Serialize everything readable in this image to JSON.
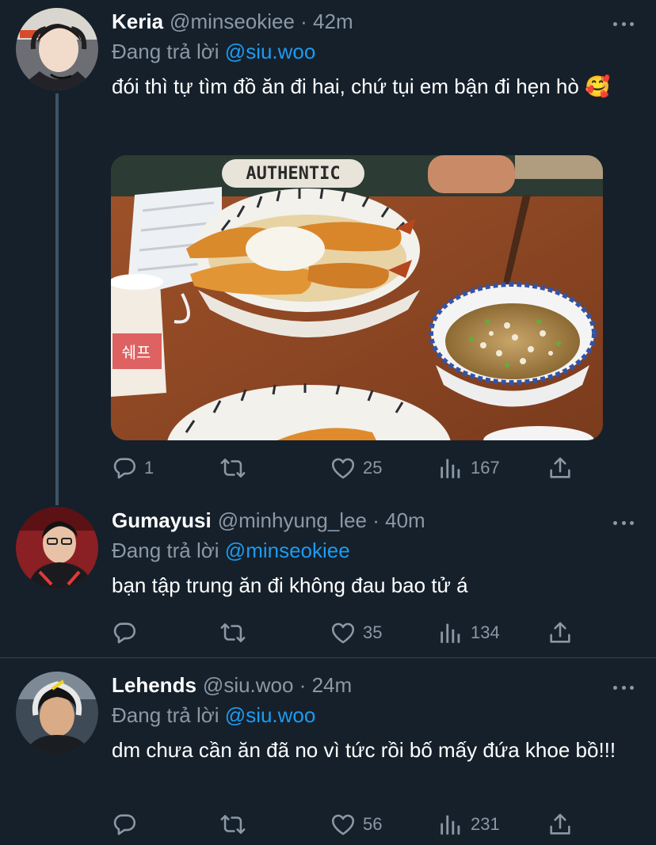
{
  "tweets": [
    {
      "name": "Keria",
      "handle": "@minseokiee · 42m",
      "reply_prefix": "Đang trả lời",
      "reply_to": "@siu.woo",
      "text": "đói thì tự tìm đồ ăn đi hai, chứ tụi em bận đi hẹn hò 🥰",
      "media_sign": "AUTHENTIC",
      "media_cup_label": "쉐프",
      "stats": {
        "replies": "1",
        "retweets": "",
        "likes": "25",
        "views": "167"
      }
    },
    {
      "name": "Gumayusi",
      "handle": "@minhyung_lee · 40m",
      "reply_prefix": "Đang trả lời",
      "reply_to": "@minseokiee",
      "text": "bạn tập trung ăn đi không đau bao tử á",
      "stats": {
        "replies": "",
        "retweets": "",
        "likes": "35",
        "views": "134"
      }
    },
    {
      "name": "Lehends",
      "handle": "@siu.woo · 24m",
      "reply_prefix": "Đang trả lời",
      "reply_to": "@siu.woo",
      "text": "dm chưa cần ăn đã no vì tức rồi bố mấy đứa khoe bồ!!!",
      "stats": {
        "replies": "",
        "retweets": "",
        "likes": "56",
        "views": "231"
      }
    }
  ],
  "colors": {
    "background": "#15202b",
    "secondary_text": "#8b98a5",
    "mention": "#1d9bf0",
    "divider": "#38444d",
    "thread_line": "#3d5466"
  },
  "icons": [
    "reply-icon",
    "retweet-icon",
    "like-icon",
    "views-icon",
    "share-icon",
    "more-icon"
  ]
}
